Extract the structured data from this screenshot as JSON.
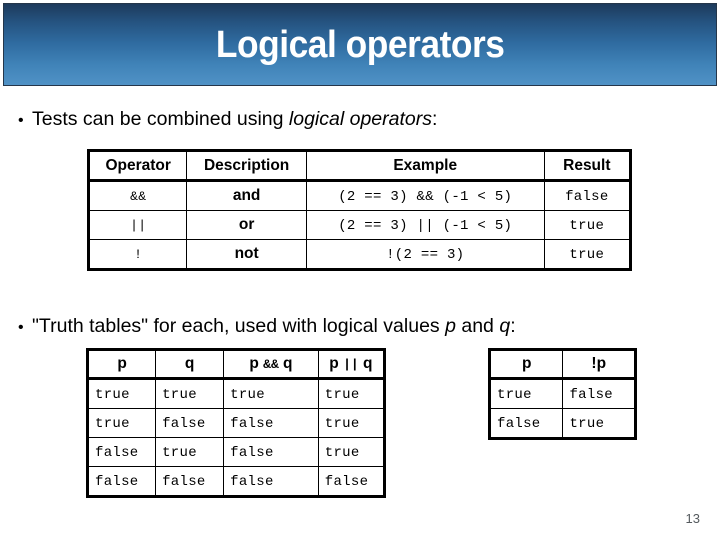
{
  "slide": {
    "title": "Logical operators",
    "number": "13"
  },
  "bullets": {
    "first": {
      "lead": "Tests can be combined using ",
      "emphasis": "logical operators",
      "trail": ":"
    },
    "second": {
      "lead": "\"Truth tables\" for each, used with logical values ",
      "emphasis_p": "p",
      "middle": " and ",
      "emphasis_q": "q",
      "trail": ":"
    }
  },
  "operators_table": {
    "headers": [
      "Operator",
      "Description",
      "Example",
      "Result"
    ],
    "rows": [
      {
        "operator": "&&",
        "description": "and",
        "example": "(2 == 3) && (-1 < 5)",
        "result": "false"
      },
      {
        "operator": "||",
        "description": "or",
        "example": "(2 == 3) || (-1 < 5)",
        "result": "true"
      },
      {
        "operator": "!",
        "description": "not",
        "example": "!(2 == 3)",
        "result": "true"
      }
    ]
  },
  "truth_table": {
    "headers": {
      "p": "p",
      "q": "q",
      "and_p": "p ",
      "and_op": "&&",
      "and_q": " q",
      "or_p": "p ",
      "or_op": "||",
      "or_q": " q"
    },
    "rows": [
      [
        "true",
        "true",
        "true",
        "true"
      ],
      [
        "true",
        "false",
        "false",
        "true"
      ],
      [
        "false",
        "true",
        "false",
        "true"
      ],
      [
        "false",
        "false",
        "false",
        "false"
      ]
    ]
  },
  "negation_table": {
    "headers": {
      "p": "p",
      "not_op": "!",
      "not_p": "p"
    },
    "rows": [
      [
        "true",
        "false"
      ],
      [
        "false",
        "true"
      ]
    ]
  }
}
